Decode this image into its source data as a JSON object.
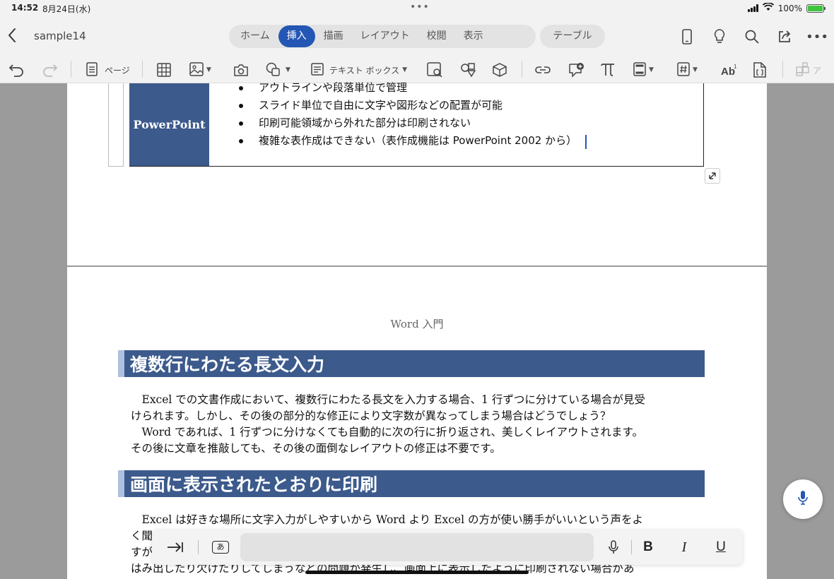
{
  "status": {
    "time": "14:52",
    "date": "8月24日(水)",
    "battery": "100%"
  },
  "header": {
    "doc_name": "sample14",
    "tabs": [
      {
        "label": "ホーム"
      },
      {
        "label": "挿入"
      },
      {
        "label": "描画"
      },
      {
        "label": "レイアウト"
      },
      {
        "label": "校閲"
      },
      {
        "label": "表示"
      }
    ],
    "extra_tab": "テーブル",
    "active_tab": "挿入"
  },
  "ribbon": {
    "page_label": "ページ",
    "textbox_label": "テキスト ボックス",
    "cutoff_label": "ア"
  },
  "doc": {
    "table": {
      "label": "PowerPoint",
      "bullets": [
        "アウトラインや段落単位で管理",
        "スライド単位で自由に文字や図形などの配置が可能",
        "印刷可能領域から外れた部分は印刷されない",
        "複雑な表作成はできない（表作成機能は PowerPoint 2002 から）"
      ]
    },
    "page_header": "Word 入門",
    "heading1": "複数行にわたる長文入力",
    "para1": [
      "　Excel での文書作成において、複数行にわたる長文を入力する場合、1 行ずつに分けている場合が見受",
      "けられます。しかし、その後の部分的な修正により文字数が異なってしまう場合はどうでしょう？",
      "　Word であれば、1 行ずつに分けなくても自動的に次の行に折り返され、美しくレイアウトされます。",
      "その後に文章を推敲しても、その後の面倒なレイアウトの修正は不要です。"
    ],
    "heading2": "画面に表示されたとおりに印刷",
    "para2": [
      "　Excel は好きな場所に文字入力がしやすいから Word より Excel の方が使い勝手がいいという声をよ",
      "く聞",
      "すが",
      "はみ出したり欠けたりしてしまうなどの問題が発生し、画面上に表示したように印刷されない場合があ"
    ]
  },
  "floatbar": {
    "bold": "B",
    "italic": "I",
    "underline": "U",
    "kana": "あ"
  },
  "colors": {
    "accent": "#2457b4",
    "heading_bg": "#3c5a8c",
    "heading_bar": "#adc0dd"
  }
}
